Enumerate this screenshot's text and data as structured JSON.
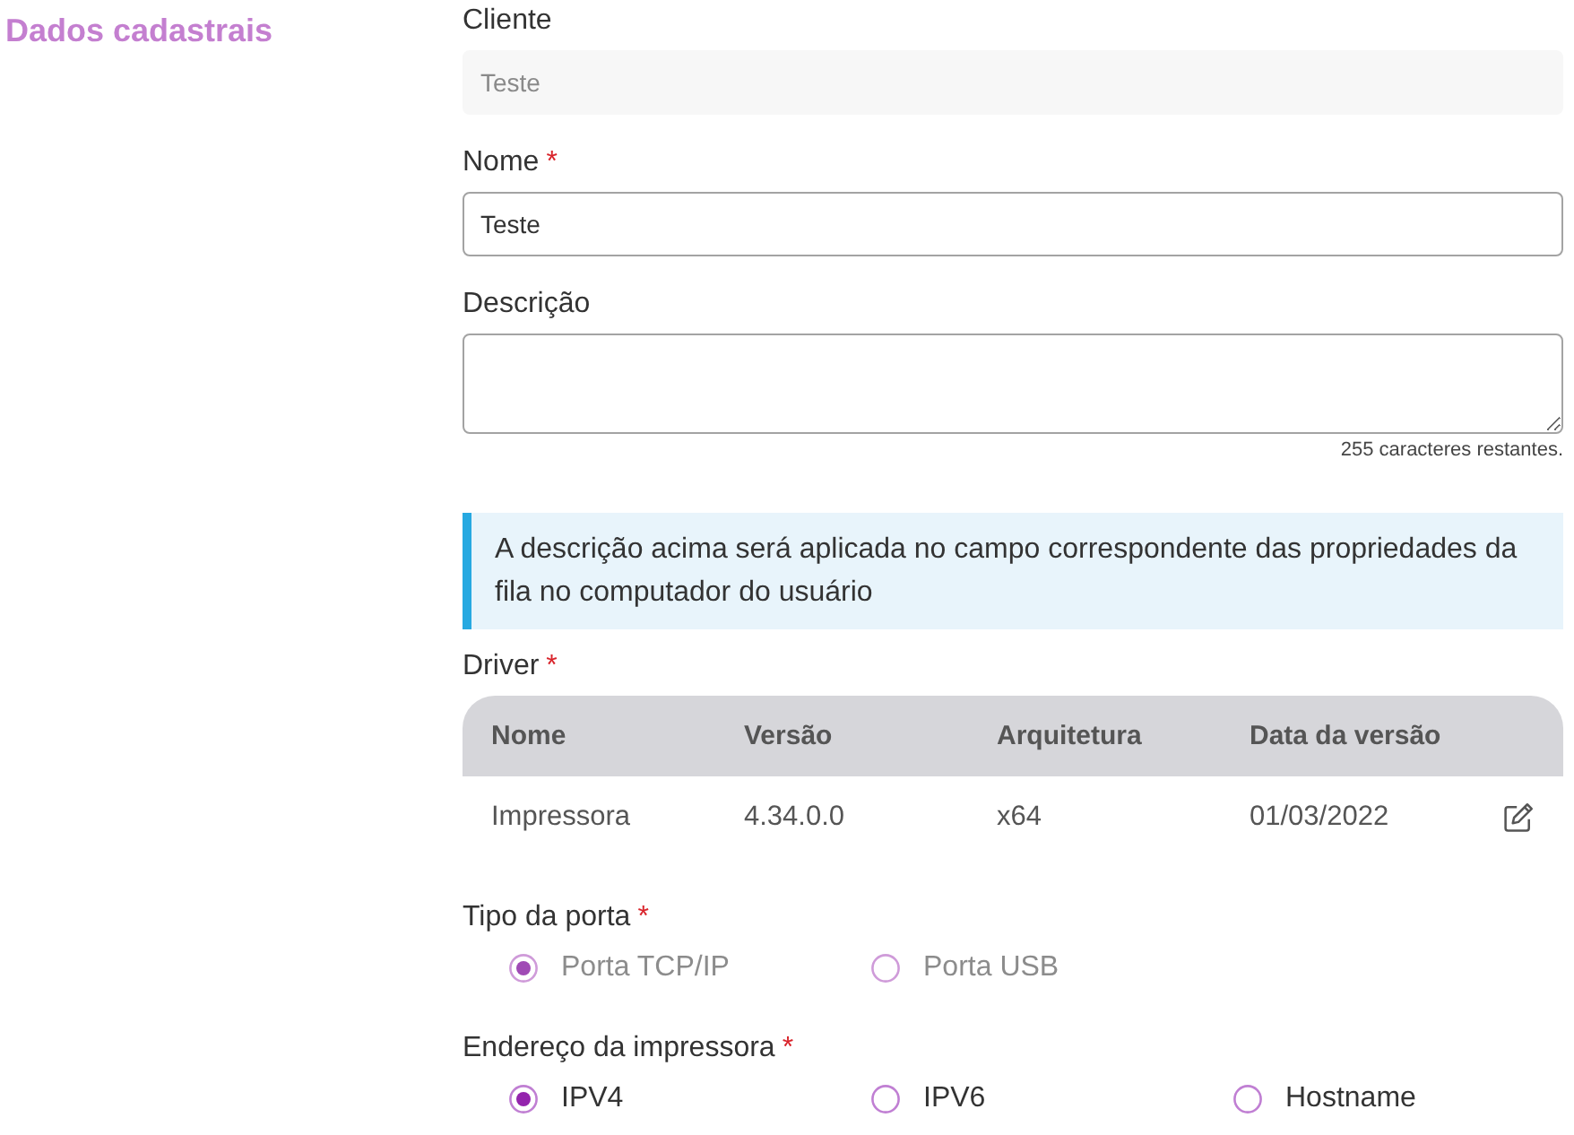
{
  "section_title": "Dados cadastrais",
  "fields": [
    {
      "kind": "input",
      "label": "Cliente",
      "disabled": true,
      "value": "Teste"
    },
    {
      "kind": "input",
      "label": "Nome",
      "required_mark": "*",
      "disabled": false,
      "value": "Teste"
    },
    {
      "kind": "textarea",
      "label": "Descrição",
      "counter": "255 caracteres restantes."
    }
  ],
  "info_note": "A descrição acima será aplicada no campo correspondente das propriedades da fila no computador do usuário",
  "driver": {
    "label": "Driver",
    "required_mark": "*",
    "table": {
      "columns": [
        "Nome",
        "Versão",
        "Arquitetura",
        "Data da versão"
      ],
      "rows": [
        {
          "cells": [
            "Impressora",
            "4.34.0.0",
            "x64",
            "01/03/2022"
          ]
        }
      ]
    }
  },
  "radio_groups": [
    {
      "label": "Tipo da porta",
      "required_mark": "*",
      "disabled": true,
      "options": [
        {
          "label": "Porta TCP/IP",
          "selected": true
        },
        {
          "label": "Porta USB",
          "selected": false
        }
      ]
    },
    {
      "label": "Endereço da impressora",
      "required_mark": "*",
      "disabled": false,
      "options": [
        {
          "label": "IPV4",
          "selected": true
        },
        {
          "label": "IPV6",
          "selected": false
        },
        {
          "label": "Hostname",
          "selected": false
        }
      ]
    }
  ]
}
